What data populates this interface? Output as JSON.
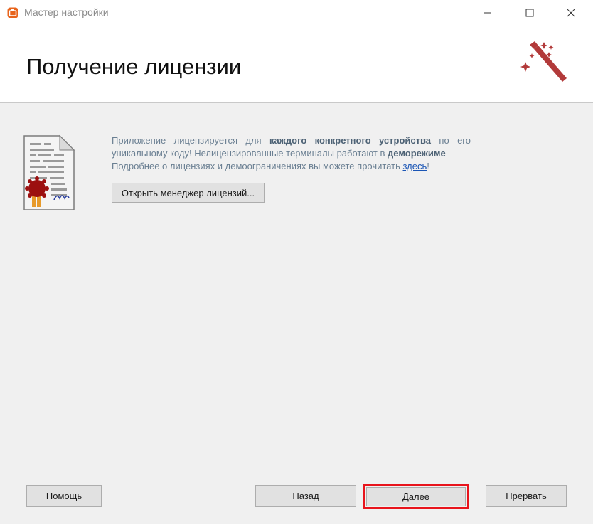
{
  "window": {
    "title": "Мастер настройки",
    "icon": "app-logo-icon",
    "accent": "#e8641c"
  },
  "header": {
    "title": "Получение лицензии",
    "icon": "magic-wand-icon",
    "icon_color": "#b23a3a"
  },
  "content": {
    "icon": "license-certificate-icon",
    "line1_a": "Приложение лицензируется для ",
    "line1_bold": "каждого конкретного устройства",
    "line1_b": " по его",
    "line2_a": "уникальному коду! Нелицензированные терминалы работают в ",
    "line2_bold": "деморежиме",
    "line3_a": "Подробнее о лицензиях и демоограничениях вы можете прочитать ",
    "line3_link": "здесь",
    "line3_b": "!",
    "license_button": "Открыть менеджер лицензий..."
  },
  "footer": {
    "help": "Помощь",
    "back": "Назад",
    "next": "Далее",
    "cancel": "Прервать",
    "highlight_color": "#e8141c"
  }
}
